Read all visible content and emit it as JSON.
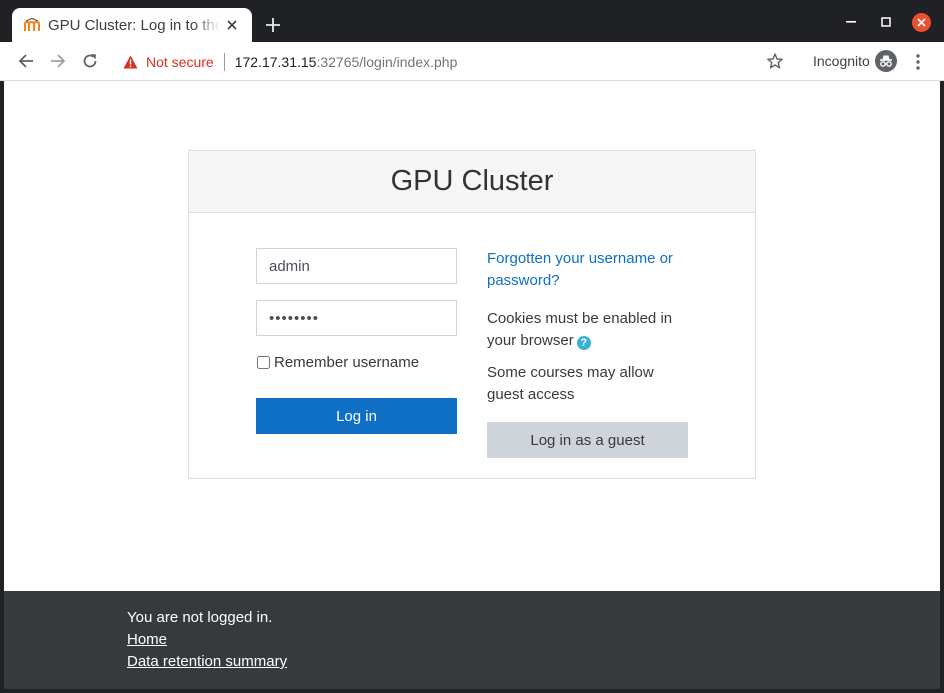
{
  "browser": {
    "tab_title": "GPU Cluster: Log in to the site",
    "new_tab_symbol": "+",
    "security_label": "Not secure",
    "url_host": "172.17.31.15",
    "url_rest": ":32765/login/index.php",
    "incognito_label": "Incognito",
    "accent_close_color": "#e8512f",
    "icons": [
      "moodle-favicon-icon",
      "close-icon",
      "plus-icon",
      "minimize-icon",
      "maximize-icon",
      "back-arrow-icon",
      "forward-arrow-icon",
      "reload-icon",
      "warning-icon",
      "star-icon",
      "incognito-icon",
      "kebab-menu-icon"
    ]
  },
  "login": {
    "site_title": "GPU Cluster",
    "username_value": "admin",
    "password_value": "••••••••",
    "remember_label": "Remember username",
    "remember_checked": false,
    "login_button": "Log in",
    "forgot_link": "Forgotten your username or password?",
    "cookies_text": "Cookies must be enabled in your browser",
    "help_symbol": "?",
    "guest_text": "Some courses may allow guest access",
    "guest_button": "Log in as a guest",
    "primary_color": "#0f6fc5",
    "help_color": "#38b1d6"
  },
  "footer": {
    "status_text": "You are not logged in.",
    "home_link": "Home",
    "data_retention_link": "Data retention summary"
  }
}
